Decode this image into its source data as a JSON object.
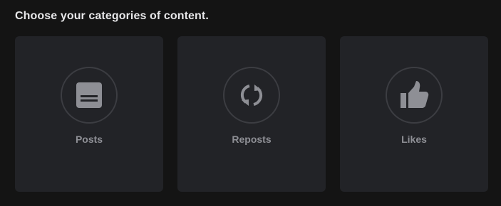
{
  "heading": "Choose your categories of content.",
  "categories": [
    {
      "label": "Posts",
      "icon": "post-icon"
    },
    {
      "label": "Reposts",
      "icon": "repost-icon"
    },
    {
      "label": "Likes",
      "icon": "thumbs-up-icon"
    }
  ],
  "colors": {
    "background": "#141414",
    "card": "#222327",
    "ring": "#3c3d42",
    "icon": "#8e8f95",
    "label": "#8e8f95",
    "heading": "#e7e7e9"
  }
}
